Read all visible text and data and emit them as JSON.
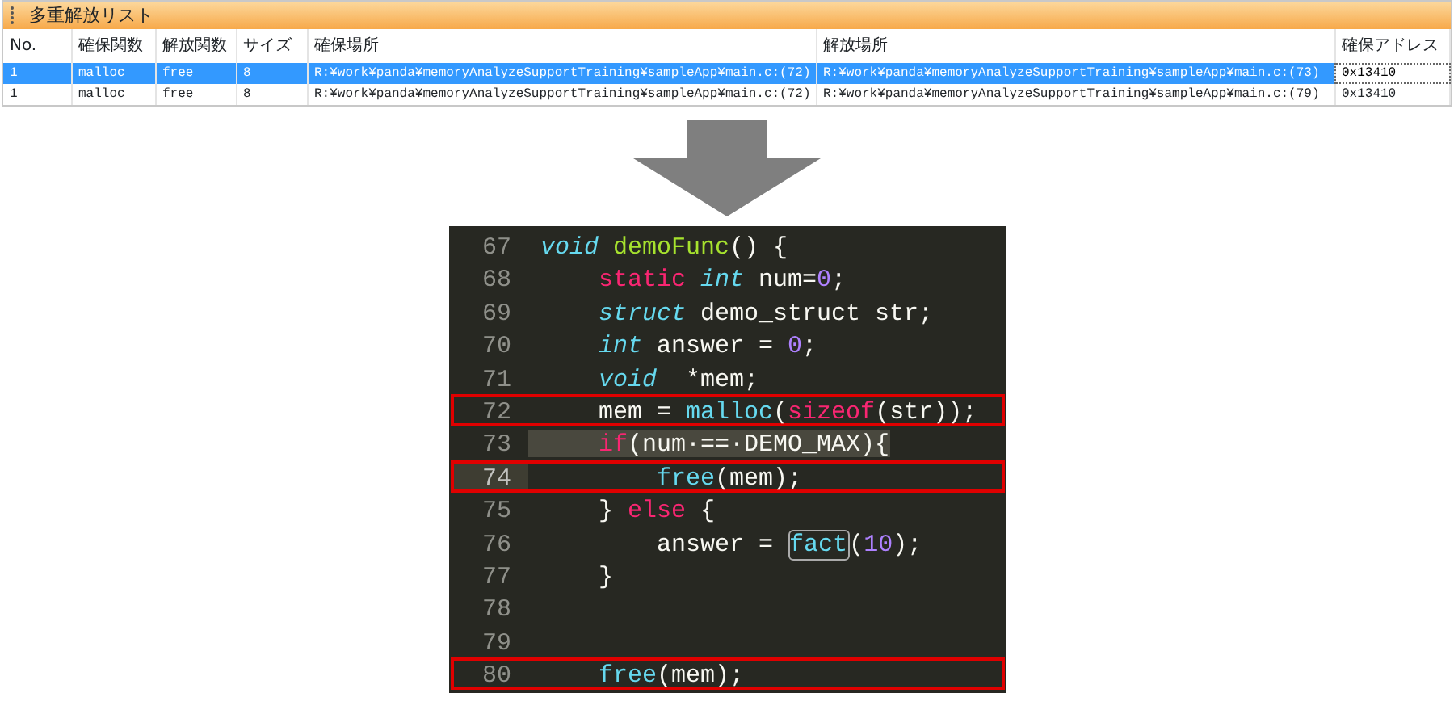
{
  "list_panel": {
    "title": "多重解放リスト",
    "columns": [
      "No.",
      "確保関数",
      "解放関数",
      "サイズ",
      "確保場所",
      "解放場所",
      "確保アドレス"
    ],
    "rows": [
      {
        "selected": true,
        "cells": [
          "1",
          "malloc",
          "free",
          "8",
          "R:¥work¥panda¥memoryAnalyzeSupportTraining¥sampleApp¥main.c:(72)",
          "R:¥work¥panda¥memoryAnalyzeSupportTraining¥sampleApp¥main.c:(73)",
          "0x13410"
        ]
      },
      {
        "selected": false,
        "cells": [
          "1",
          "malloc",
          "free",
          "8",
          "R:¥work¥panda¥memoryAnalyzeSupportTraining¥sampleApp¥main.c:(72)",
          "R:¥work¥panda¥memoryAnalyzeSupportTraining¥sampleApp¥main.c:(79)",
          "0x13410"
        ]
      }
    ]
  },
  "code_editor": {
    "lines": [
      {
        "number": "67",
        "marked": false,
        "current": false,
        "selected": false,
        "tokens": [
          {
            "kind": "type",
            "text": "void"
          },
          {
            "kind": "func",
            "text": " demoFunc"
          },
          {
            "kind": "plain",
            "text": "() {"
          }
        ]
      },
      {
        "number": "68",
        "marked": false,
        "current": false,
        "selected": false,
        "tokens": [
          {
            "kind": "keyword",
            "text": "    static"
          },
          {
            "kind": "type",
            "text": " int"
          },
          {
            "kind": "plain",
            "text": " num="
          },
          {
            "kind": "number",
            "text": "0"
          },
          {
            "kind": "plain",
            "text": ";"
          }
        ]
      },
      {
        "number": "69",
        "marked": false,
        "current": false,
        "selected": false,
        "tokens": [
          {
            "kind": "type",
            "text": "    struct"
          },
          {
            "kind": "plain",
            "text": " demo_struct str;"
          }
        ]
      },
      {
        "number": "70",
        "marked": false,
        "current": false,
        "selected": false,
        "tokens": [
          {
            "kind": "type",
            "text": "    int"
          },
          {
            "kind": "plain",
            "text": " answer = "
          },
          {
            "kind": "number",
            "text": "0"
          },
          {
            "kind": "plain",
            "text": ";"
          }
        ]
      },
      {
        "number": "71",
        "marked": false,
        "current": false,
        "selected": false,
        "tokens": [
          {
            "kind": "type",
            "text": "    void"
          },
          {
            "kind": "plain",
            "text": "  *mem;"
          }
        ]
      },
      {
        "number": "72",
        "marked": true,
        "current": false,
        "selected": false,
        "tokens": [
          {
            "kind": "plain",
            "text": "    mem = "
          },
          {
            "kind": "builtin",
            "text": "malloc"
          },
          {
            "kind": "plain",
            "text": "("
          },
          {
            "kind": "keyword",
            "text": "sizeof"
          },
          {
            "kind": "plain",
            "text": "(str));"
          }
        ]
      },
      {
        "number": "73",
        "marked": false,
        "current": false,
        "selected": true,
        "tokens": [
          {
            "kind": "keyword",
            "text": "    if"
          },
          {
            "kind": "plain",
            "text": "(num·==·DEMO_MAX){"
          }
        ]
      },
      {
        "number": "74",
        "marked": true,
        "current": true,
        "selected": false,
        "tokens": [
          {
            "kind": "builtin",
            "text": "        free"
          },
          {
            "kind": "plain",
            "text": "(mem);"
          }
        ]
      },
      {
        "number": "75",
        "marked": false,
        "current": false,
        "selected": false,
        "tokens": [
          {
            "kind": "plain",
            "text": "    } "
          },
          {
            "kind": "keyword",
            "text": "else"
          },
          {
            "kind": "plain",
            "text": " {"
          }
        ]
      },
      {
        "number": "76",
        "marked": false,
        "current": false,
        "selected": false,
        "tokens": [
          {
            "kind": "plain",
            "text": "        answer = "
          },
          {
            "kind": "builtin",
            "text": "fact",
            "boxed": true
          },
          {
            "kind": "plain",
            "text": "("
          },
          {
            "kind": "number",
            "text": "10"
          },
          {
            "kind": "plain",
            "text": ");"
          }
        ]
      },
      {
        "number": "77",
        "marked": false,
        "current": false,
        "selected": false,
        "tokens": [
          {
            "kind": "plain",
            "text": "    }"
          }
        ]
      },
      {
        "number": "78",
        "marked": false,
        "current": false,
        "selected": false
      },
      {
        "number": "79",
        "marked": false,
        "current": false,
        "selected": false
      },
      {
        "number": "80",
        "marked": true,
        "current": false,
        "selected": false,
        "tokens": [
          {
            "kind": "builtin",
            "text": "    free"
          },
          {
            "kind": "plain",
            "text": "(mem);"
          }
        ]
      }
    ]
  }
}
